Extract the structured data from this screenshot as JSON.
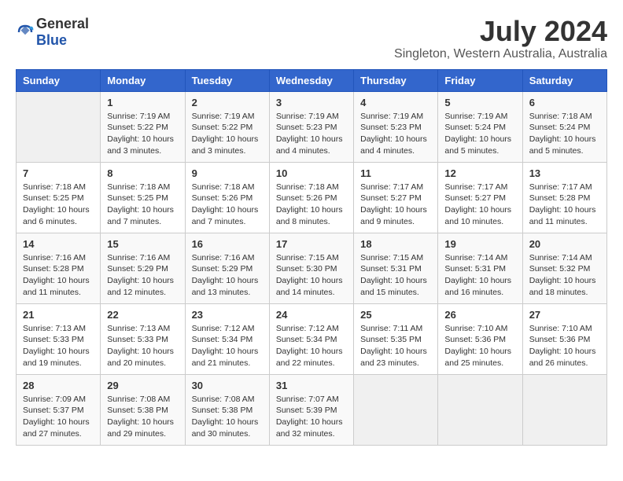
{
  "header": {
    "logo_general": "General",
    "logo_blue": "Blue",
    "month_year": "July 2024",
    "location": "Singleton, Western Australia, Australia"
  },
  "calendar": {
    "days_of_week": [
      "Sunday",
      "Monday",
      "Tuesday",
      "Wednesday",
      "Thursday",
      "Friday",
      "Saturday"
    ],
    "weeks": [
      [
        {
          "day": "",
          "info": ""
        },
        {
          "day": "1",
          "info": "Sunrise: 7:19 AM\nSunset: 5:22 PM\nDaylight: 10 hours\nand 3 minutes."
        },
        {
          "day": "2",
          "info": "Sunrise: 7:19 AM\nSunset: 5:22 PM\nDaylight: 10 hours\nand 3 minutes."
        },
        {
          "day": "3",
          "info": "Sunrise: 7:19 AM\nSunset: 5:23 PM\nDaylight: 10 hours\nand 4 minutes."
        },
        {
          "day": "4",
          "info": "Sunrise: 7:19 AM\nSunset: 5:23 PM\nDaylight: 10 hours\nand 4 minutes."
        },
        {
          "day": "5",
          "info": "Sunrise: 7:19 AM\nSunset: 5:24 PM\nDaylight: 10 hours\nand 5 minutes."
        },
        {
          "day": "6",
          "info": "Sunrise: 7:18 AM\nSunset: 5:24 PM\nDaylight: 10 hours\nand 5 minutes."
        }
      ],
      [
        {
          "day": "7",
          "info": "Sunrise: 7:18 AM\nSunset: 5:25 PM\nDaylight: 10 hours\nand 6 minutes."
        },
        {
          "day": "8",
          "info": "Sunrise: 7:18 AM\nSunset: 5:25 PM\nDaylight: 10 hours\nand 7 minutes."
        },
        {
          "day": "9",
          "info": "Sunrise: 7:18 AM\nSunset: 5:26 PM\nDaylight: 10 hours\nand 7 minutes."
        },
        {
          "day": "10",
          "info": "Sunrise: 7:18 AM\nSunset: 5:26 PM\nDaylight: 10 hours\nand 8 minutes."
        },
        {
          "day": "11",
          "info": "Sunrise: 7:17 AM\nSunset: 5:27 PM\nDaylight: 10 hours\nand 9 minutes."
        },
        {
          "day": "12",
          "info": "Sunrise: 7:17 AM\nSunset: 5:27 PM\nDaylight: 10 hours\nand 10 minutes."
        },
        {
          "day": "13",
          "info": "Sunrise: 7:17 AM\nSunset: 5:28 PM\nDaylight: 10 hours\nand 11 minutes."
        }
      ],
      [
        {
          "day": "14",
          "info": "Sunrise: 7:16 AM\nSunset: 5:28 PM\nDaylight: 10 hours\nand 11 minutes."
        },
        {
          "day": "15",
          "info": "Sunrise: 7:16 AM\nSunset: 5:29 PM\nDaylight: 10 hours\nand 12 minutes."
        },
        {
          "day": "16",
          "info": "Sunrise: 7:16 AM\nSunset: 5:29 PM\nDaylight: 10 hours\nand 13 minutes."
        },
        {
          "day": "17",
          "info": "Sunrise: 7:15 AM\nSunset: 5:30 PM\nDaylight: 10 hours\nand 14 minutes."
        },
        {
          "day": "18",
          "info": "Sunrise: 7:15 AM\nSunset: 5:31 PM\nDaylight: 10 hours\nand 15 minutes."
        },
        {
          "day": "19",
          "info": "Sunrise: 7:14 AM\nSunset: 5:31 PM\nDaylight: 10 hours\nand 16 minutes."
        },
        {
          "day": "20",
          "info": "Sunrise: 7:14 AM\nSunset: 5:32 PM\nDaylight: 10 hours\nand 18 minutes."
        }
      ],
      [
        {
          "day": "21",
          "info": "Sunrise: 7:13 AM\nSunset: 5:33 PM\nDaylight: 10 hours\nand 19 minutes."
        },
        {
          "day": "22",
          "info": "Sunrise: 7:13 AM\nSunset: 5:33 PM\nDaylight: 10 hours\nand 20 minutes."
        },
        {
          "day": "23",
          "info": "Sunrise: 7:12 AM\nSunset: 5:34 PM\nDaylight: 10 hours\nand 21 minutes."
        },
        {
          "day": "24",
          "info": "Sunrise: 7:12 AM\nSunset: 5:34 PM\nDaylight: 10 hours\nand 22 minutes."
        },
        {
          "day": "25",
          "info": "Sunrise: 7:11 AM\nSunset: 5:35 PM\nDaylight: 10 hours\nand 23 minutes."
        },
        {
          "day": "26",
          "info": "Sunrise: 7:10 AM\nSunset: 5:36 PM\nDaylight: 10 hours\nand 25 minutes."
        },
        {
          "day": "27",
          "info": "Sunrise: 7:10 AM\nSunset: 5:36 PM\nDaylight: 10 hours\nand 26 minutes."
        }
      ],
      [
        {
          "day": "28",
          "info": "Sunrise: 7:09 AM\nSunset: 5:37 PM\nDaylight: 10 hours\nand 27 minutes."
        },
        {
          "day": "29",
          "info": "Sunrise: 7:08 AM\nSunset: 5:38 PM\nDaylight: 10 hours\nand 29 minutes."
        },
        {
          "day": "30",
          "info": "Sunrise: 7:08 AM\nSunset: 5:38 PM\nDaylight: 10 hours\nand 30 minutes."
        },
        {
          "day": "31",
          "info": "Sunrise: 7:07 AM\nSunset: 5:39 PM\nDaylight: 10 hours\nand 32 minutes."
        },
        {
          "day": "",
          "info": ""
        },
        {
          "day": "",
          "info": ""
        },
        {
          "day": "",
          "info": ""
        }
      ]
    ]
  }
}
